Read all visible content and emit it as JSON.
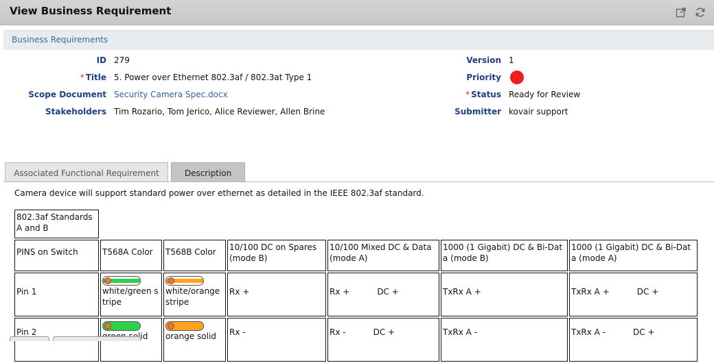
{
  "window": {
    "title": "View Business Requirement",
    "icons": [
      "external-link-icon",
      "refresh-icon"
    ]
  },
  "section": {
    "title": "Business Requirements"
  },
  "fields": {
    "id_label": "ID",
    "id_value": "279",
    "title_required": "*",
    "title_label": "Title",
    "title_value": "5. Power over Ethernet 802.3af / 802.3at Type 1",
    "scope_label": "Scope Document",
    "scope_value": "Security Camera Spec.docx",
    "stakeholders_label": "Stakeholders",
    "stakeholders_value": "Tim Rozario, Tom Jerico, Alice Reviewer, Allen Brine",
    "version_label": "Version",
    "version_value": "1",
    "priority_label": "Priority",
    "priority_color": "#ee1c1c",
    "status_required": "*",
    "status_label": "Status",
    "status_value": "Ready for Review",
    "submitter_label": "Submitter",
    "submitter_value": "kovair support"
  },
  "tabs": [
    {
      "label": "Associated Functional Requirement",
      "active": false
    },
    {
      "label": "Description",
      "active": true
    }
  ],
  "description": {
    "text": "Camera device will support standard power over ethernet as detailed in the IEEE 802.3af standard.",
    "table": {
      "caption": "802.3af Standards A and B",
      "headers": [
        "PINS on Switch",
        "T568A Color",
        "T568B Color",
        "10/100 DC on Spares (mode B)",
        "10/100 Mixed DC & Data (mode A)",
        "1000 (1 Gigabit) DC & Bi-Data (mode B)",
        "1000 (1 Gigabit) DC & Bi-Data (mode A)"
      ],
      "rows": [
        {
          "pin": "Pin 1",
          "t568a": "white/green stripe",
          "t568b": "white/orange stripe",
          "c1": "Rx +",
          "c2a": "Rx +",
          "c2b": "DC +",
          "c3": "TxRx A +",
          "c4a": "TxRx A +",
          "c4b": "DC +"
        },
        {
          "pin": "Pin 2",
          "t568a": "green solid",
          "t568b": "orange solid",
          "c1": "Rx -",
          "c2a": "Rx -",
          "c2b": "DC +",
          "c3": "TxRx A -",
          "c4a": "TxRx A -",
          "c4b": "DC +"
        }
      ]
    }
  }
}
